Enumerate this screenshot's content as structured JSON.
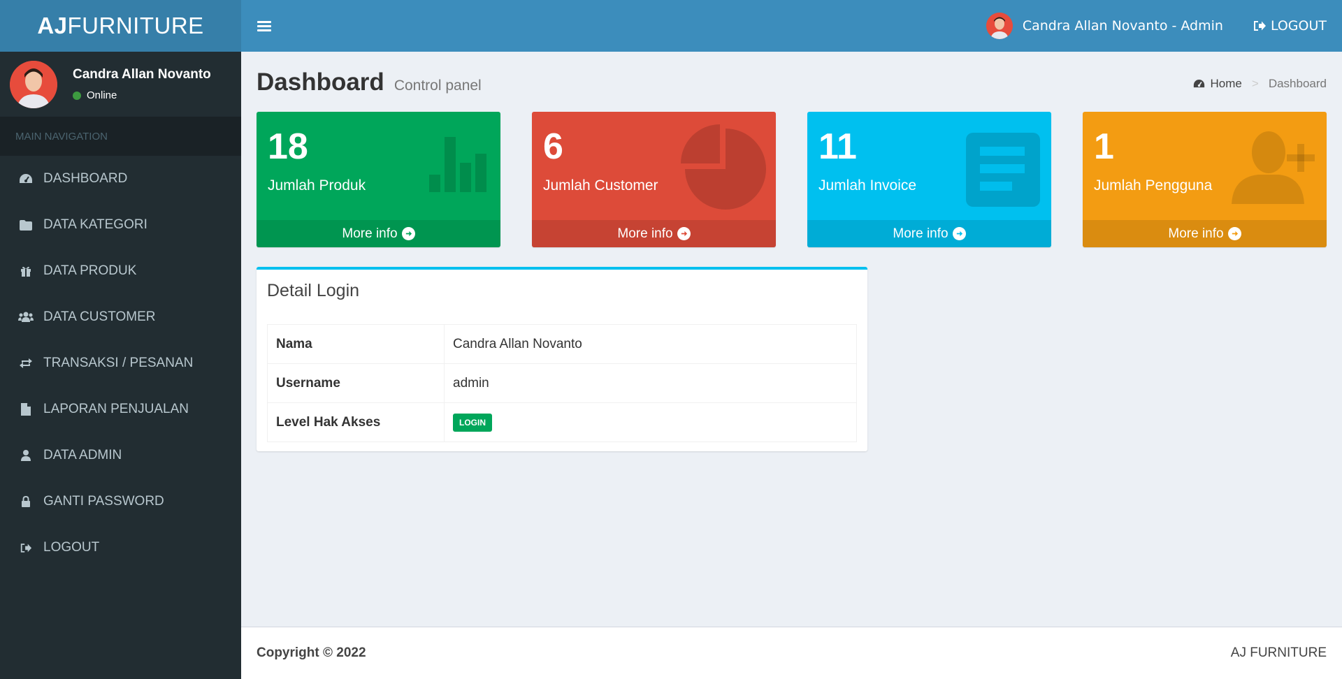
{
  "brand": {
    "bold": "AJ",
    "light": "FURNITURE"
  },
  "header": {
    "user_label": "Candra Allan Novanto - Admin",
    "logout_label": "LOGOUT"
  },
  "sidebar": {
    "user_name": "Candra Allan Novanto",
    "status": "Online",
    "nav_header": "MAIN NAVIGATION",
    "items": [
      {
        "label": "DASHBOARD",
        "icon": "dashboard-icon"
      },
      {
        "label": "DATA KATEGORI",
        "icon": "folder-icon"
      },
      {
        "label": "DATA PRODUK",
        "icon": "gift-icon"
      },
      {
        "label": "DATA CUSTOMER",
        "icon": "users-icon"
      },
      {
        "label": "TRANSAKSI / PESANAN",
        "icon": "exchange-icon"
      },
      {
        "label": "LAPORAN PENJUALAN",
        "icon": "file-icon"
      },
      {
        "label": "DATA ADMIN",
        "icon": "user-icon"
      },
      {
        "label": "GANTI PASSWORD",
        "icon": "lock-icon"
      },
      {
        "label": "LOGOUT",
        "icon": "sign-out-icon"
      }
    ]
  },
  "content": {
    "title": "Dashboard",
    "subtitle": "Control panel",
    "breadcrumb": {
      "home": "Home",
      "current": "Dashboard"
    }
  },
  "stat_boxes": [
    {
      "value": "18",
      "label": "Jumlah Produk",
      "more": "More info",
      "color": "#00a65a",
      "icon": "bar-chart-icon"
    },
    {
      "value": "6",
      "label": "Jumlah Customer",
      "more": "More info",
      "color": "#dd4b39",
      "icon": "pie-chart-icon"
    },
    {
      "value": "11",
      "label": "Jumlah Invoice",
      "more": "More info",
      "color": "#00c0ef",
      "icon": "list-alt-icon"
    },
    {
      "value": "1",
      "label": "Jumlah Pengguna",
      "more": "More info",
      "color": "#f39c12",
      "icon": "user-plus-icon"
    }
  ],
  "detail_login": {
    "title": "Detail Login",
    "rows": [
      {
        "key": "Nama",
        "value": "Candra Allan Novanto"
      },
      {
        "key": "Username",
        "value": "admin"
      },
      {
        "key": "Level Hak Akses",
        "badge": "LOGIN"
      }
    ]
  },
  "footer": {
    "copyright": "Copyright © 2022",
    "brand": "AJ FURNITURE"
  }
}
